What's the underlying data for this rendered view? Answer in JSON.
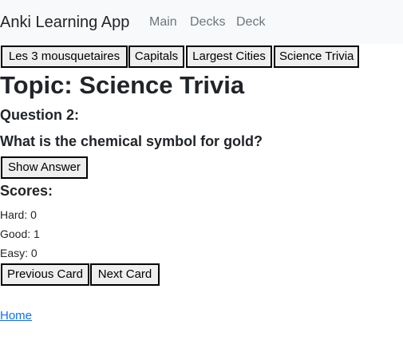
{
  "navbar": {
    "brand": "Anki Learning App",
    "links": [
      "Main",
      "Decks",
      "Deck"
    ]
  },
  "decks": [
    "Les 3 mousquetaires",
    "Capitals",
    "Largest Cities",
    "Science Trivia"
  ],
  "topic": {
    "label": "Topic: Science Trivia"
  },
  "question": {
    "number_label": "Question 2:",
    "text": "What is the chemical symbol for gold?"
  },
  "show_answer_label": "Show Answer",
  "scores": {
    "heading": "Scores:",
    "hard": "Hard: 0",
    "good": "Good: 1",
    "easy": "Easy: 0"
  },
  "navigation": {
    "previous_label": "Previous Card",
    "next_label": "Next Card"
  },
  "home_link": "Home"
}
